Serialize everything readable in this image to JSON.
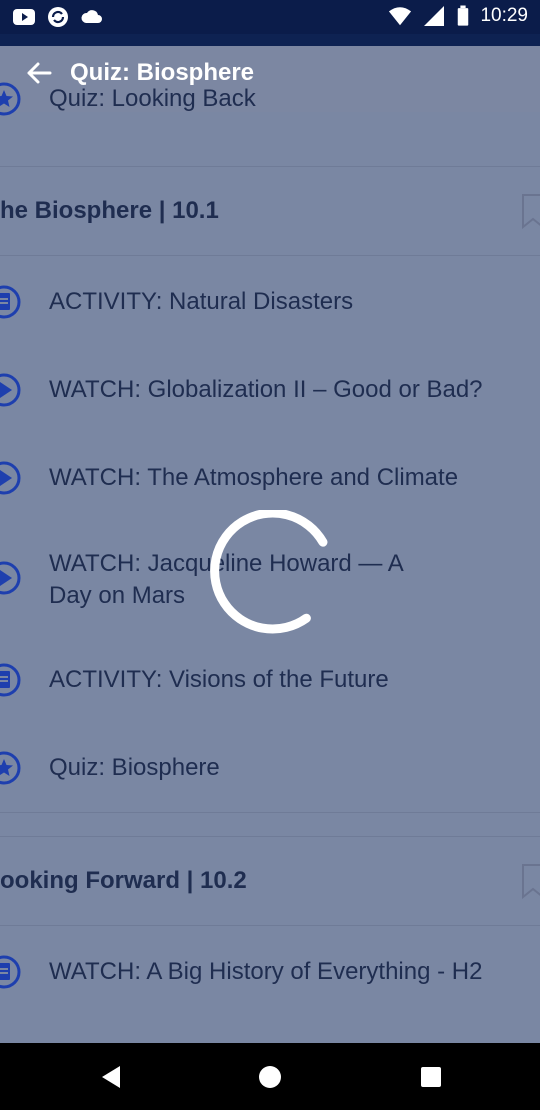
{
  "status_bar": {
    "time": "10:29",
    "left_icons": [
      "youtube-icon",
      "sync-icon",
      "cloud-icon"
    ],
    "right_icons": [
      "wifi-icon",
      "signal-icon",
      "battery-icon"
    ]
  },
  "app_bar": {
    "title": "Quiz: Biosphere",
    "partial_item_label": "Quiz: Looking Back"
  },
  "sections": [
    {
      "title": "he Biosphere | 10.1",
      "items": [
        {
          "type": "activity",
          "label": "ACTIVITY: Natural Disasters",
          "icon": "document-icon"
        },
        {
          "type": "watch",
          "label": "WATCH: Globalization II – Good or Bad?",
          "icon": "play-icon"
        },
        {
          "type": "watch",
          "label": "WATCH: The Atmosphere and Climate",
          "icon": "play-icon"
        },
        {
          "type": "watch",
          "label_line1": "WATCH: Jacqueline Howard — A",
          "label_line2": "Day on Mars",
          "icon": "play-icon"
        },
        {
          "type": "activity",
          "label": "ACTIVITY: Visions of the Future",
          "icon": "document-icon"
        },
        {
          "type": "quiz",
          "label": "Quiz: Biosphere",
          "icon": "star-icon"
        }
      ]
    },
    {
      "title": "ooking Forward | 10.2",
      "items": [
        {
          "type": "watch",
          "label": "WATCH: A Big History of Everything - H2",
          "icon": "document-icon"
        }
      ]
    }
  ],
  "colors": {
    "status_bar": "#0b1c4a",
    "overlay": "#7a87a3",
    "text": "#1f2d50",
    "icon": "#1e3fae",
    "spinner": "#ffffff"
  }
}
